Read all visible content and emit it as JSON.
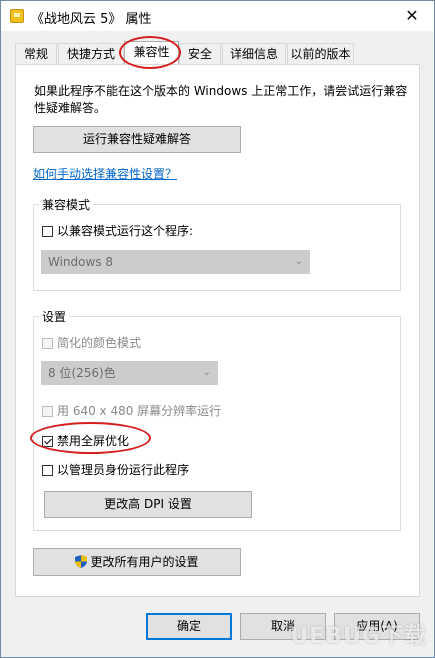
{
  "window": {
    "title": "《战地风云 5》 属性",
    "close_glyph": "✕"
  },
  "tabs": [
    {
      "label": "常规"
    },
    {
      "label": "快捷方式"
    },
    {
      "label": "兼容性"
    },
    {
      "label": "安全"
    },
    {
      "label": "详细信息"
    },
    {
      "label": "以前的版本"
    }
  ],
  "compat": {
    "description": "如果此程序不能在这个版本的 Windows 上正常工作，请尝试运行兼容性疑难解答。",
    "troubleshoot_button": "运行兼容性疑难解答",
    "manual_link": "如何手动选择兼容性设置？"
  },
  "compat_mode": {
    "legend": "兼容模式",
    "run_checkbox": "以兼容模式运行这个程序:",
    "os_select": "Windows 8"
  },
  "settings": {
    "legend": "设置",
    "reduced_color": "简化的颜色模式",
    "color_select": "8 位(256)色",
    "resolution_640": "用 640 x 480 屏幕分辨率运行",
    "disable_fullscreen": "禁用全屏优化",
    "run_as_admin": "以管理员身份运行此程序",
    "dpi_button": "更改高 DPI 设置"
  },
  "all_users_button": "更改所有用户的设置",
  "footer": {
    "ok": "确定",
    "cancel": "取消",
    "apply": "应用(A)"
  },
  "watermark": "UEBUG下载",
  "colors": {
    "accent": "#0078d7",
    "highlight": "#d51f1f",
    "link": "#0066cc"
  },
  "icons": {
    "app": "app-icon",
    "shield": "uac-shield-icon",
    "close": "close-icon"
  }
}
